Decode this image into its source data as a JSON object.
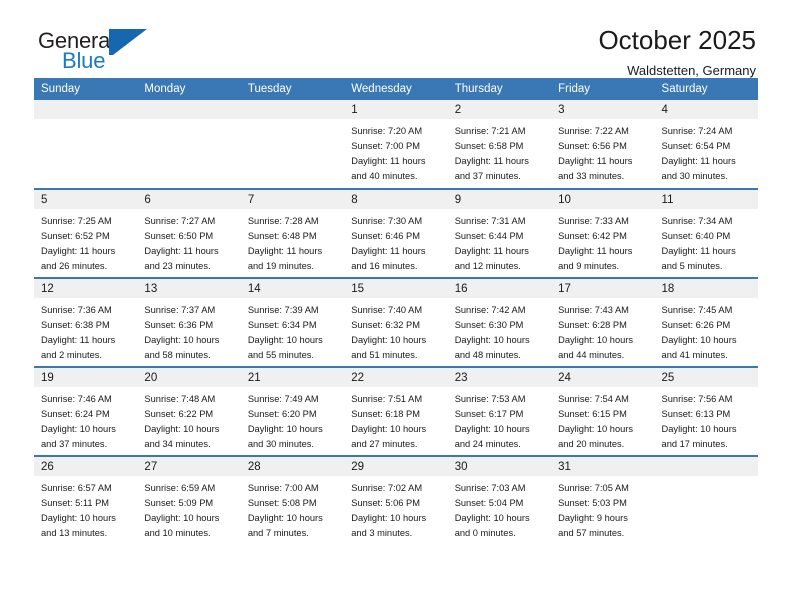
{
  "logo": {
    "word_one": "General",
    "word_two": "Blue",
    "mark_name": "general-blue-triangle-logo",
    "accent_color": "#1b7bc4",
    "mark_color": "#1667ad"
  },
  "header": {
    "title": "October 2025",
    "subtitle": "Waldstetten, Germany"
  },
  "colors": {
    "header_row_background": "#3a78b5",
    "header_row_text": "#ffffff",
    "daynum_background": "#f0f0f0",
    "cell_background": "#ffffff",
    "body_text": "#1a1a1a"
  },
  "calendar": {
    "weekday_headers": [
      "Sunday",
      "Monday",
      "Tuesday",
      "Wednesday",
      "Thursday",
      "Friday",
      "Saturday"
    ],
    "weeks": [
      [
        {
          "day": "",
          "empty": true,
          "sunrise": "",
          "sunset": "",
          "daylight_line1": "",
          "daylight_line2": ""
        },
        {
          "day": "",
          "empty": true,
          "sunrise": "",
          "sunset": "",
          "daylight_line1": "",
          "daylight_line2": ""
        },
        {
          "day": "",
          "empty": true,
          "sunrise": "",
          "sunset": "",
          "daylight_line1": "",
          "daylight_line2": ""
        },
        {
          "day": "1",
          "empty": false,
          "sunrise": "Sunrise: 7:20 AM",
          "sunset": "Sunset: 7:00 PM",
          "daylight_line1": "Daylight: 11 hours",
          "daylight_line2": "and 40 minutes."
        },
        {
          "day": "2",
          "empty": false,
          "sunrise": "Sunrise: 7:21 AM",
          "sunset": "Sunset: 6:58 PM",
          "daylight_line1": "Daylight: 11 hours",
          "daylight_line2": "and 37 minutes."
        },
        {
          "day": "3",
          "empty": false,
          "sunrise": "Sunrise: 7:22 AM",
          "sunset": "Sunset: 6:56 PM",
          "daylight_line1": "Daylight: 11 hours",
          "daylight_line2": "and 33 minutes."
        },
        {
          "day": "4",
          "empty": false,
          "sunrise": "Sunrise: 7:24 AM",
          "sunset": "Sunset: 6:54 PM",
          "daylight_line1": "Daylight: 11 hours",
          "daylight_line2": "and 30 minutes."
        }
      ],
      [
        {
          "day": "5",
          "empty": false,
          "sunrise": "Sunrise: 7:25 AM",
          "sunset": "Sunset: 6:52 PM",
          "daylight_line1": "Daylight: 11 hours",
          "daylight_line2": "and 26 minutes."
        },
        {
          "day": "6",
          "empty": false,
          "sunrise": "Sunrise: 7:27 AM",
          "sunset": "Sunset: 6:50 PM",
          "daylight_line1": "Daylight: 11 hours",
          "daylight_line2": "and 23 minutes."
        },
        {
          "day": "7",
          "empty": false,
          "sunrise": "Sunrise: 7:28 AM",
          "sunset": "Sunset: 6:48 PM",
          "daylight_line1": "Daylight: 11 hours",
          "daylight_line2": "and 19 minutes."
        },
        {
          "day": "8",
          "empty": false,
          "sunrise": "Sunrise: 7:30 AM",
          "sunset": "Sunset: 6:46 PM",
          "daylight_line1": "Daylight: 11 hours",
          "daylight_line2": "and 16 minutes."
        },
        {
          "day": "9",
          "empty": false,
          "sunrise": "Sunrise: 7:31 AM",
          "sunset": "Sunset: 6:44 PM",
          "daylight_line1": "Daylight: 11 hours",
          "daylight_line2": "and 12 minutes."
        },
        {
          "day": "10",
          "empty": false,
          "sunrise": "Sunrise: 7:33 AM",
          "sunset": "Sunset: 6:42 PM",
          "daylight_line1": "Daylight: 11 hours",
          "daylight_line2": "and 9 minutes."
        },
        {
          "day": "11",
          "empty": false,
          "sunrise": "Sunrise: 7:34 AM",
          "sunset": "Sunset: 6:40 PM",
          "daylight_line1": "Daylight: 11 hours",
          "daylight_line2": "and 5 minutes."
        }
      ],
      [
        {
          "day": "12",
          "empty": false,
          "sunrise": "Sunrise: 7:36 AM",
          "sunset": "Sunset: 6:38 PM",
          "daylight_line1": "Daylight: 11 hours",
          "daylight_line2": "and 2 minutes."
        },
        {
          "day": "13",
          "empty": false,
          "sunrise": "Sunrise: 7:37 AM",
          "sunset": "Sunset: 6:36 PM",
          "daylight_line1": "Daylight: 10 hours",
          "daylight_line2": "and 58 minutes."
        },
        {
          "day": "14",
          "empty": false,
          "sunrise": "Sunrise: 7:39 AM",
          "sunset": "Sunset: 6:34 PM",
          "daylight_line1": "Daylight: 10 hours",
          "daylight_line2": "and 55 minutes."
        },
        {
          "day": "15",
          "empty": false,
          "sunrise": "Sunrise: 7:40 AM",
          "sunset": "Sunset: 6:32 PM",
          "daylight_line1": "Daylight: 10 hours",
          "daylight_line2": "and 51 minutes."
        },
        {
          "day": "16",
          "empty": false,
          "sunrise": "Sunrise: 7:42 AM",
          "sunset": "Sunset: 6:30 PM",
          "daylight_line1": "Daylight: 10 hours",
          "daylight_line2": "and 48 minutes."
        },
        {
          "day": "17",
          "empty": false,
          "sunrise": "Sunrise: 7:43 AM",
          "sunset": "Sunset: 6:28 PM",
          "daylight_line1": "Daylight: 10 hours",
          "daylight_line2": "and 44 minutes."
        },
        {
          "day": "18",
          "empty": false,
          "sunrise": "Sunrise: 7:45 AM",
          "sunset": "Sunset: 6:26 PM",
          "daylight_line1": "Daylight: 10 hours",
          "daylight_line2": "and 41 minutes."
        }
      ],
      [
        {
          "day": "19",
          "empty": false,
          "sunrise": "Sunrise: 7:46 AM",
          "sunset": "Sunset: 6:24 PM",
          "daylight_line1": "Daylight: 10 hours",
          "daylight_line2": "and 37 minutes."
        },
        {
          "day": "20",
          "empty": false,
          "sunrise": "Sunrise: 7:48 AM",
          "sunset": "Sunset: 6:22 PM",
          "daylight_line1": "Daylight: 10 hours",
          "daylight_line2": "and 34 minutes."
        },
        {
          "day": "21",
          "empty": false,
          "sunrise": "Sunrise: 7:49 AM",
          "sunset": "Sunset: 6:20 PM",
          "daylight_line1": "Daylight: 10 hours",
          "daylight_line2": "and 30 minutes."
        },
        {
          "day": "22",
          "empty": false,
          "sunrise": "Sunrise: 7:51 AM",
          "sunset": "Sunset: 6:18 PM",
          "daylight_line1": "Daylight: 10 hours",
          "daylight_line2": "and 27 minutes."
        },
        {
          "day": "23",
          "empty": false,
          "sunrise": "Sunrise: 7:53 AM",
          "sunset": "Sunset: 6:17 PM",
          "daylight_line1": "Daylight: 10 hours",
          "daylight_line2": "and 24 minutes."
        },
        {
          "day": "24",
          "empty": false,
          "sunrise": "Sunrise: 7:54 AM",
          "sunset": "Sunset: 6:15 PM",
          "daylight_line1": "Daylight: 10 hours",
          "daylight_line2": "and 20 minutes."
        },
        {
          "day": "25",
          "empty": false,
          "sunrise": "Sunrise: 7:56 AM",
          "sunset": "Sunset: 6:13 PM",
          "daylight_line1": "Daylight: 10 hours",
          "daylight_line2": "and 17 minutes."
        }
      ],
      [
        {
          "day": "26",
          "empty": false,
          "sunrise": "Sunrise: 6:57 AM",
          "sunset": "Sunset: 5:11 PM",
          "daylight_line1": "Daylight: 10 hours",
          "daylight_line2": "and 13 minutes."
        },
        {
          "day": "27",
          "empty": false,
          "sunrise": "Sunrise: 6:59 AM",
          "sunset": "Sunset: 5:09 PM",
          "daylight_line1": "Daylight: 10 hours",
          "daylight_line2": "and 10 minutes."
        },
        {
          "day": "28",
          "empty": false,
          "sunrise": "Sunrise: 7:00 AM",
          "sunset": "Sunset: 5:08 PM",
          "daylight_line1": "Daylight: 10 hours",
          "daylight_line2": "and 7 minutes."
        },
        {
          "day": "29",
          "empty": false,
          "sunrise": "Sunrise: 7:02 AM",
          "sunset": "Sunset: 5:06 PM",
          "daylight_line1": "Daylight: 10 hours",
          "daylight_line2": "and 3 minutes."
        },
        {
          "day": "30",
          "empty": false,
          "sunrise": "Sunrise: 7:03 AM",
          "sunset": "Sunset: 5:04 PM",
          "daylight_line1": "Daylight: 10 hours",
          "daylight_line2": "and 0 minutes."
        },
        {
          "day": "31",
          "empty": false,
          "sunrise": "Sunrise: 7:05 AM",
          "sunset": "Sunset: 5:03 PM",
          "daylight_line1": "Daylight: 9 hours",
          "daylight_line2": "and 57 minutes."
        },
        {
          "day": "",
          "empty": true,
          "sunrise": "",
          "sunset": "",
          "daylight_line1": "",
          "daylight_line2": ""
        }
      ]
    ]
  }
}
